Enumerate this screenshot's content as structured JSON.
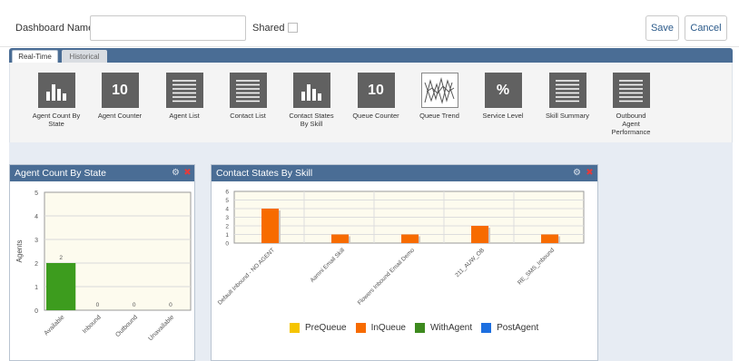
{
  "header": {
    "dashboard_name_label": "Dashboard Name",
    "dashboard_name_value": "",
    "shared_label": "Shared",
    "save_label": "Save",
    "cancel_label": "Cancel"
  },
  "tabs": [
    {
      "label": "Real-Time"
    },
    {
      "label": "Historical"
    }
  ],
  "palette": [
    {
      "label": "Agent Count By State",
      "icon": "bar-chart-icon"
    },
    {
      "label": "Agent Counter",
      "icon": "counter-icon",
      "glyph": "10"
    },
    {
      "label": "Agent List",
      "icon": "list-icon"
    },
    {
      "label": "Contact List",
      "icon": "list-icon"
    },
    {
      "label": "Contact States By Skill",
      "icon": "bar-chart-icon"
    },
    {
      "label": "Queue Counter",
      "icon": "counter-icon",
      "glyph": "10"
    },
    {
      "label": "Queue Trend",
      "icon": "trend-icon"
    },
    {
      "label": "Service Level",
      "icon": "percent-icon",
      "glyph": "%"
    },
    {
      "label": "Skill Summary",
      "icon": "list-icon"
    },
    {
      "label": "Outbound Agent Performance",
      "icon": "list-icon"
    }
  ],
  "widgets": {
    "agent_count": {
      "title": "Agent Count By State"
    },
    "contact_states": {
      "title": "Contact States By Skill"
    }
  },
  "chart_data": [
    {
      "type": "bar",
      "title": "Agent Count By State",
      "categories": [
        "Available",
        "Inbound",
        "Outbound",
        "Unavailable"
      ],
      "values": [
        2,
        0,
        0,
        0
      ],
      "data_labels": [
        "2",
        "0",
        "0",
        "0"
      ],
      "ylabel": "Agents",
      "xlabel": "",
      "ylim": [
        0,
        5
      ],
      "yticks": [
        "0",
        "1",
        "2",
        "3",
        "4",
        "5"
      ],
      "colors": {
        "bar": "#3d9c1e",
        "bg": "#fdfbee"
      },
      "grid": true
    },
    {
      "type": "bar",
      "title": "Contact States By Skill",
      "categories": [
        "Default Inbound - NO AGENT",
        "Aamni Email Skill",
        "Flowers Inbound Email Demo",
        "211_AUW_OB",
        "RE_SMS_Inbound"
      ],
      "series": [
        {
          "name": "PreQueue",
          "values": [
            0,
            0,
            0,
            0,
            0
          ],
          "color": "#f5c400"
        },
        {
          "name": "InQueue",
          "values": [
            4,
            1,
            1,
            2,
            1
          ],
          "color": "#f76b00"
        },
        {
          "name": "WithAgent",
          "values": [
            0,
            0,
            0,
            0,
            0
          ],
          "color": "#3d8a1e"
        },
        {
          "name": "PostAgent",
          "values": [
            0,
            0,
            0,
            0,
            0
          ],
          "color": "#1d6fe0"
        }
      ],
      "ylim": [
        0,
        6
      ],
      "yticks": [
        "0",
        "1",
        "2",
        "3",
        "4",
        "5",
        "6"
      ],
      "grid": true,
      "legend": "bottom"
    }
  ]
}
